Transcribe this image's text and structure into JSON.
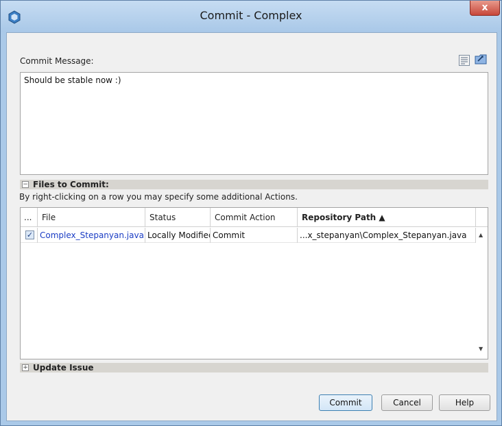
{
  "window": {
    "title": "Commit - Complex",
    "close_label": "x"
  },
  "message": {
    "label": "Commit Message:",
    "text": "Should be stable now :)"
  },
  "files_section": {
    "title": "Files to Commit:",
    "toggle": "−",
    "hint": "By right-clicking on a row you may specify some additional Actions."
  },
  "table": {
    "columns": [
      "...",
      "File",
      "Status",
      "Commit Action",
      "Repository Path ▲"
    ],
    "rows": [
      {
        "checked": "✓",
        "file": "Complex_Stepanyan.java",
        "status": "Locally Modified",
        "action": "Commit",
        "path": "...x_stepanyan\\Complex_Stepanyan.java"
      }
    ],
    "scroll_up": "▲",
    "scroll_down": "▼"
  },
  "update_section": {
    "title": "Update Issue",
    "toggle": "+"
  },
  "buttons": {
    "commit": "Commit",
    "cancel": "Cancel",
    "help": "Help"
  },
  "icons": {
    "app": "netbeans-cube-icon",
    "tool1": "template-list-icon",
    "tool2": "history-folder-icon"
  }
}
